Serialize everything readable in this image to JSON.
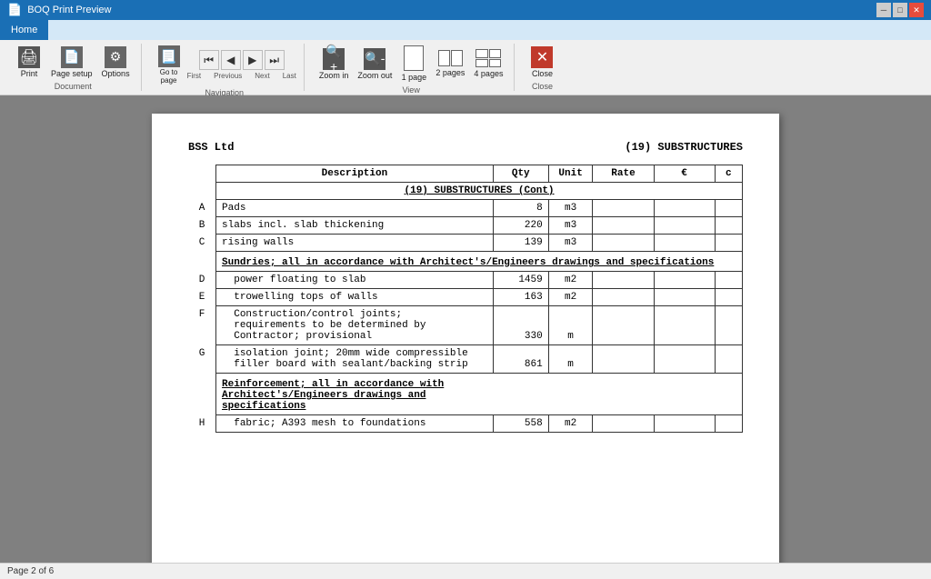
{
  "titleBar": {
    "title": "BOQ Print Preview",
    "controls": [
      "minimize",
      "restore",
      "close"
    ]
  },
  "ribbon": {
    "tab": "Home",
    "groups": [
      {
        "name": "Document",
        "label": "Document",
        "buttons": [
          {
            "id": "print-btn",
            "label": "Print",
            "icon": "🖨"
          },
          {
            "id": "page-setup-btn",
            "label": "Page setup",
            "icon": "📄"
          },
          {
            "id": "options-btn",
            "label": "Options",
            "icon": "⚙"
          }
        ]
      },
      {
        "name": "Navigation",
        "label": "Navigation",
        "buttons": [
          {
            "id": "go-to-page-btn",
            "label": "Go to page",
            "icon": "📃"
          },
          {
            "id": "first-btn",
            "label": "First",
            "icon": "⏮"
          },
          {
            "id": "prev-btn",
            "label": "Previous",
            "icon": "◀"
          },
          {
            "id": "next-btn",
            "label": "Next",
            "icon": "▶"
          },
          {
            "id": "last-btn",
            "label": "Last",
            "icon": "⏭"
          }
        ]
      },
      {
        "name": "View",
        "label": "View",
        "buttons": [
          {
            "id": "zoom-in-btn",
            "label": "Zoom in",
            "icon": "🔍"
          },
          {
            "id": "zoom-out-btn",
            "label": "Zoom out",
            "icon": "🔍"
          },
          {
            "id": "1page-btn",
            "label": "1 page"
          },
          {
            "id": "2pages-btn",
            "label": "2 pages"
          },
          {
            "id": "4pages-btn",
            "label": "4 pages"
          }
        ]
      },
      {
        "name": "Close",
        "label": "Close",
        "buttons": [
          {
            "id": "close-btn",
            "label": "Close",
            "icon": "✕"
          }
        ]
      }
    ]
  },
  "document": {
    "company": "BSS Ltd",
    "section": "(19)  SUBSTRUCTURES",
    "tableHeaders": {
      "description": "Description",
      "qty": "Qty",
      "unit": "Unit",
      "rate": "Rate",
      "euro": "€",
      "c": "c"
    },
    "sectionTitle": "(19) SUBSTRUCTURES (Cont)",
    "rows": [
      {
        "ref": "A",
        "description": "Pads",
        "qty": "8",
        "unit": "m3",
        "rate": "",
        "euro": "",
        "c": ""
      },
      {
        "ref": "B",
        "description": "slabs incl. slab thickening",
        "qty": "220",
        "unit": "m3",
        "rate": "",
        "euro": "",
        "c": ""
      },
      {
        "ref": "C",
        "description": "rising walls",
        "qty": "139",
        "unit": "m3",
        "rate": "",
        "euro": "",
        "c": ""
      },
      {
        "ref": "",
        "description": "Sundries; all in accordance with Architect's/Engineers drawings and specifications",
        "descClass": "bold-underline",
        "qty": "",
        "unit": "",
        "rate": "",
        "euro": "",
        "c": ""
      },
      {
        "ref": "D",
        "description": "power floating to slab",
        "qty": "1459",
        "unit": "m2",
        "rate": "",
        "euro": "",
        "c": ""
      },
      {
        "ref": "E",
        "description": "trowelling tops of walls",
        "qty": "163",
        "unit": "m2",
        "rate": "",
        "euro": "",
        "c": ""
      },
      {
        "ref": "F",
        "description": "Construction/control joints;\nrequirements to be determined by\nContractor; provisional",
        "qty": "330",
        "unit": "m",
        "rate": "",
        "euro": "",
        "c": ""
      },
      {
        "ref": "G",
        "description": "isolation joint; 20mm wide compressible\nfiller board with sealant/backing strip",
        "qty": "861",
        "unit": "m",
        "rate": "",
        "euro": "",
        "c": ""
      },
      {
        "ref": "",
        "description": "Reinforcement; all in accordance with Architect's/Engineers drawings and specifications",
        "descClass": "bold-underline",
        "qty": "",
        "unit": "",
        "rate": "",
        "euro": "",
        "c": ""
      },
      {
        "ref": "H",
        "description": "fabric; A393 mesh to foundations",
        "qty": "558",
        "unit": "m2",
        "rate": "",
        "euro": "",
        "c": ""
      }
    ]
  },
  "statusBar": {
    "pageInfo": "Page 2 of 6"
  }
}
